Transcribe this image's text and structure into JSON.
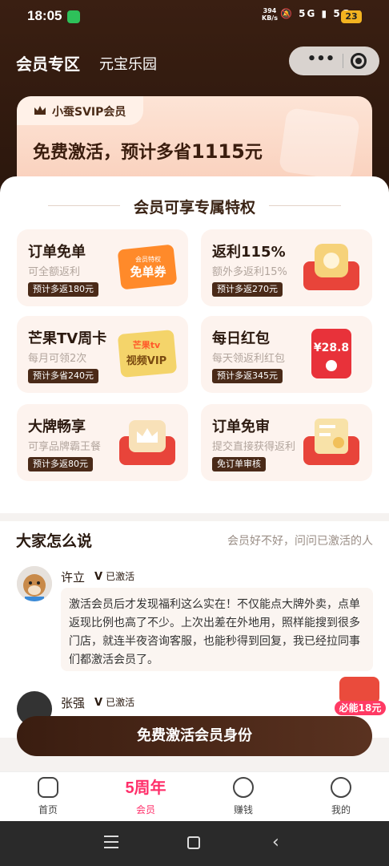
{
  "status_bar": {
    "time": "18:05",
    "net_speed_value": "394",
    "net_speed_unit": "KB/s",
    "signal_1": "5G",
    "signal_2": "5G",
    "battery": "23"
  },
  "nav": {
    "title": "会员专区",
    "subtitle": "元宝乐园",
    "more": "•••"
  },
  "svip": {
    "badge": "小蚕SVIP会员",
    "headline_prefix": "免费激活，预计多省",
    "headline_amount": "1115",
    "headline_suffix": "元"
  },
  "privileges": {
    "title": "会员可享专属特权",
    "items": [
      {
        "title": "订单免单",
        "subtitle": "可全额返利",
        "tag": "预计多返180元",
        "art_line1": "会员特权",
        "art_line2": "免单券"
      },
      {
        "title": "返利115%",
        "subtitle": "额外多返利15%",
        "tag": "预计多返270元"
      },
      {
        "title": "芒果TV周卡",
        "subtitle": "每月可领2次",
        "tag": "预计多省240元",
        "art_line1": "芒果tv",
        "art_line2": "视频VIP"
      },
      {
        "title": "每日红包",
        "subtitle": "每天领返利红包",
        "tag": "预计多返345元",
        "art_amount": "¥28.8"
      },
      {
        "title": "大牌畅享",
        "subtitle": "可享品牌霸王餐",
        "tag": "预计多返80元"
      },
      {
        "title": "订单免审",
        "subtitle": "提交直接获得返利",
        "tag": "免订单审核"
      }
    ]
  },
  "reviews": {
    "title": "大家怎么说",
    "subtitle": "会员好不好，问问已激活的人",
    "list": [
      {
        "name": "许立",
        "badge_v": "V",
        "badge_text": "已激活",
        "content": "激活会员后才发现福利这么实在！不仅能点大牌外卖，点单返现比例也高了不少。上次出差在外地用，照样能搜到很多门店，就连半夜咨询客服，也能秒得到回复，我已经拉同事们都激活会员了。"
      },
      {
        "name": "张强",
        "badge_v": "V",
        "badge_text": "已激活"
      }
    ]
  },
  "float_badge": {
    "label": "必能18元"
  },
  "cta": {
    "label": "免费激活会员身份"
  },
  "tabbar": {
    "items": [
      {
        "label": "首页",
        "icon": "home-icon"
      },
      {
        "label": "会员",
        "big": "5周年",
        "active": true
      },
      {
        "label": "赚钱",
        "icon": "money-bag-icon"
      },
      {
        "label": "我的",
        "icon": "profile-face-icon"
      }
    ]
  },
  "colors": {
    "header_bg": "#2a160c",
    "accent_pink": "#ff2f6a",
    "tag_brown": "#4a2a18",
    "card_bg": "#fdf3ee"
  }
}
